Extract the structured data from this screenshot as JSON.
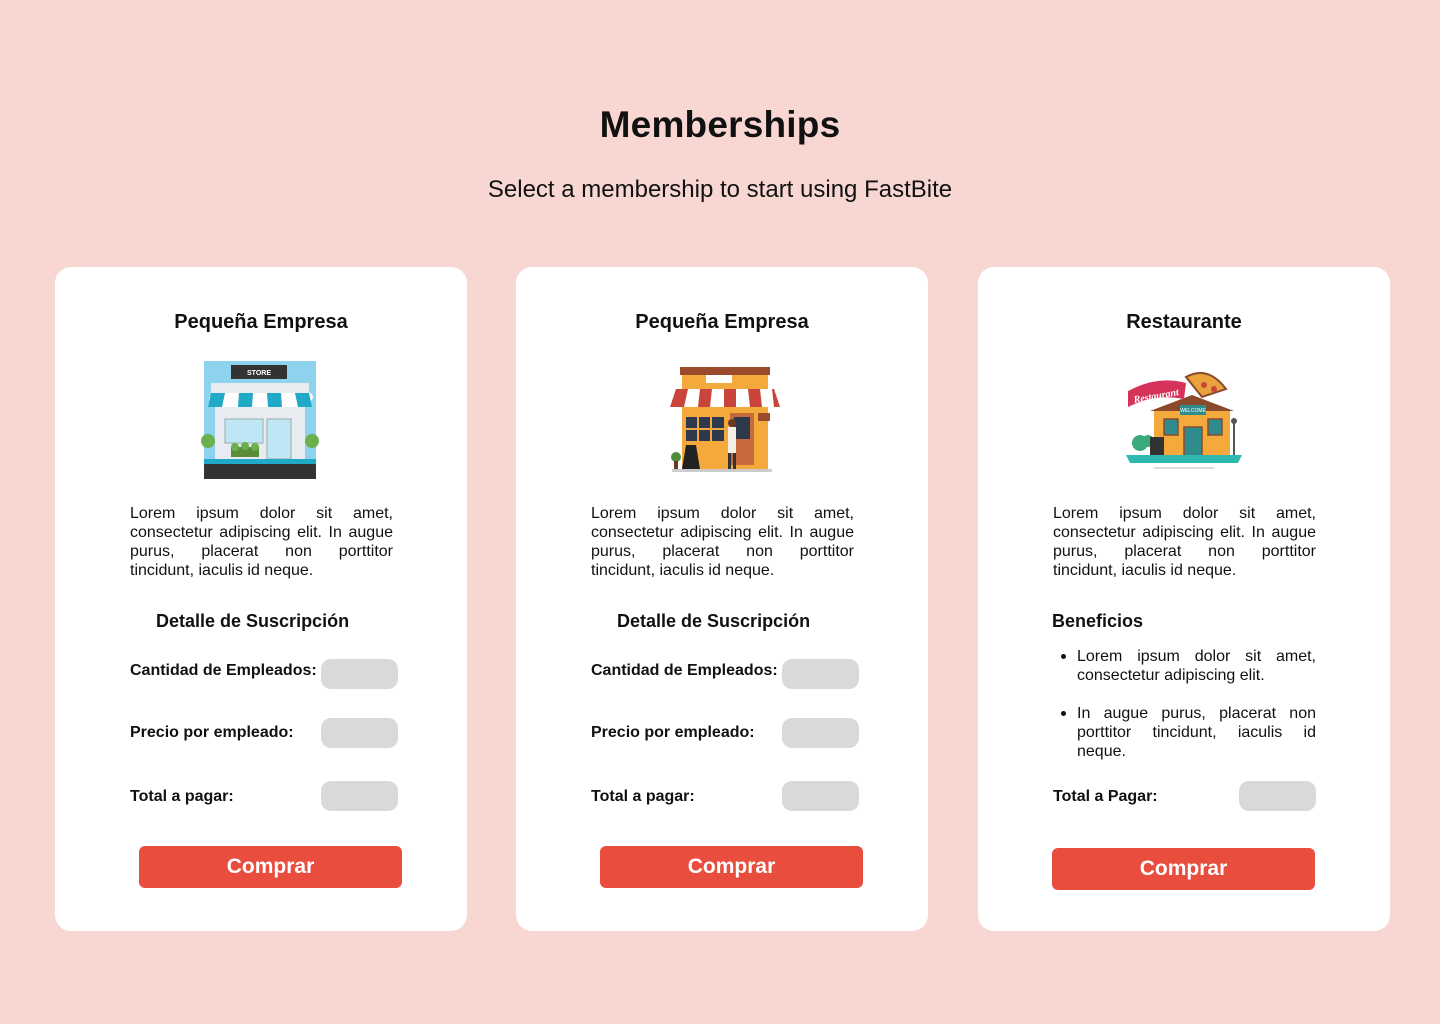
{
  "page": {
    "title": "Memberships",
    "subtitle": "Select a membership to start using FastBite"
  },
  "cards": [
    {
      "title": "Pequeña Empresa",
      "illustration": "store-icon",
      "description": "Lorem ipsum dolor sit amet, consectetur adipiscing elit. In augue purus, placerat non porttitor tincidunt, iaculis id neque.",
      "section_title": "Detalle de Suscripción",
      "rows": [
        {
          "label": "Cantidad de Empleados:",
          "value": ""
        },
        {
          "label": "Precio por empleado:",
          "value": ""
        },
        {
          "label": "Total a pagar:",
          "value": ""
        }
      ],
      "button": "Comprar"
    },
    {
      "title": "Pequeña Empresa",
      "illustration": "shop-icon",
      "description": "Lorem ipsum dolor sit amet, consectetur adipiscing elit. In augue purus, placerat non porttitor tincidunt, iaculis id neque.",
      "section_title": "Detalle de Suscripción",
      "rows": [
        {
          "label": "Cantidad de Empleados:",
          "value": ""
        },
        {
          "label": "Precio por empleado:",
          "value": ""
        },
        {
          "label": "Total a pagar:",
          "value": ""
        }
      ],
      "button": "Comprar"
    },
    {
      "title": "Restaurante",
      "illustration": "restaurant-icon",
      "description": "Lorem ipsum dolor sit amet, consectetur adipiscing elit. In augue purus, placerat non porttitor tincidunt, iaculis id neque.",
      "section_title": "Beneficios",
      "benefits": [
        "Lorem ipsum dolor sit amet, consectetur adipiscing elit.",
        "In augue purus, placerat non porttitor tincidunt, iaculis id neque."
      ],
      "rows": [
        {
          "label": "Total a Pagar:",
          "value": ""
        }
      ],
      "button": "Comprar"
    }
  ],
  "illustration_texts": {
    "store_sign": "STORE",
    "restaurant_sign": "Restaurant",
    "welcome_sign": "WELCOME"
  },
  "colors": {
    "background": "#F8D7D3",
    "card": "#FFFFFF",
    "button": "#E84D3D",
    "pill": "#D9D9D9"
  }
}
